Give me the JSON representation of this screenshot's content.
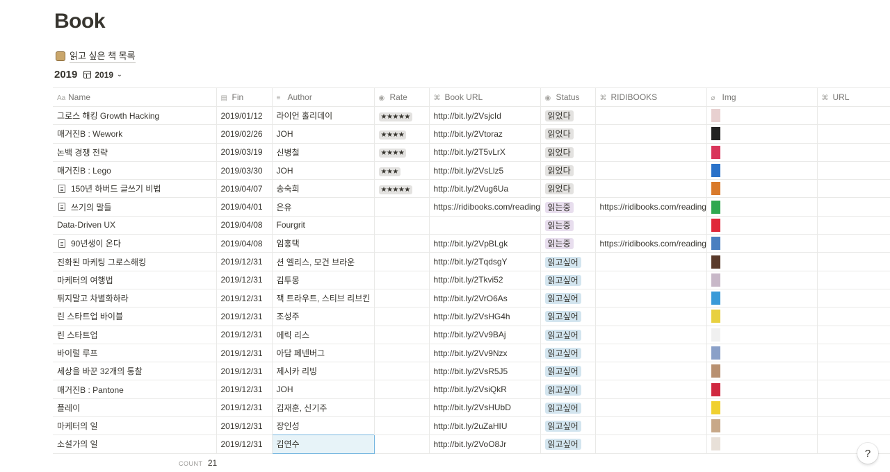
{
  "page": {
    "title": "Book"
  },
  "description": {
    "icon": "books-emoji-icon",
    "text": "읽고 싶은 책 목록"
  },
  "view": {
    "name": "2019",
    "switcher_label": "2019"
  },
  "columns": [
    {
      "label": "Name",
      "icon": "Aa"
    },
    {
      "label": "Fin",
      "icon": "▤"
    },
    {
      "label": "Author",
      "icon": "≡"
    },
    {
      "label": "Rate",
      "icon": "◉"
    },
    {
      "label": "Book URL",
      "icon": "⌘"
    },
    {
      "label": "Status",
      "icon": "◉"
    },
    {
      "label": "RIDIBOOKS",
      "icon": "⌘"
    },
    {
      "label": "Img",
      "icon": "⌀"
    },
    {
      "label": "URL",
      "icon": "⌘"
    }
  ],
  "rows": [
    {
      "name": "그로스 해킹 Growth Hacking",
      "doc": false,
      "fin": "2019/01/12",
      "author": "라이언 홀리데이",
      "rate": "★★★★★",
      "book_url": "http://bit.ly/2VsjcId",
      "status": "읽었다",
      "ridi": "",
      "img_color": "#e8d0d0"
    },
    {
      "name": "매거진B : Wework",
      "doc": false,
      "fin": "2019/02/26",
      "author": "JOH",
      "rate": "★★★★",
      "book_url": "http://bit.ly/2Vtoraz",
      "status": "읽었다",
      "ridi": "",
      "img_color": "#222222"
    },
    {
      "name": "논백 경쟁 전략",
      "doc": false,
      "fin": "2019/03/19",
      "author": "신병철",
      "rate": "★★★★",
      "book_url": "http://bit.ly/2T5vLrX",
      "status": "읽었다",
      "ridi": "",
      "img_color": "#d9355a"
    },
    {
      "name": "매거진B : Lego",
      "doc": false,
      "fin": "2019/03/30",
      "author": "JOH",
      "rate": "★★★",
      "book_url": "http://bit.ly/2VsLlz5",
      "status": "읽었다",
      "ridi": "",
      "img_color": "#2a72c9"
    },
    {
      "name": "150년 하버드 글쓰기 비법",
      "doc": true,
      "fin": "2019/04/07",
      "author": "송숙희",
      "rate": "★★★★★",
      "book_url": "http://bit.ly/2Vug6Ua",
      "status": "읽었다",
      "ridi": "",
      "img_color": "#d97a2b"
    },
    {
      "name": "쓰기의 말들",
      "doc": true,
      "fin": "2019/04/01",
      "author": "은유",
      "rate": "",
      "book_url": "https://ridibooks.com/reading",
      "status": "읽는중",
      "ridi": "https://ridibooks.com/reading",
      "img_color": "#2fa84f"
    },
    {
      "name": "Data-Driven UX",
      "doc": false,
      "fin": "2019/04/08",
      "author": "Fourgrit",
      "rate": "",
      "book_url": "",
      "status": "읽는중",
      "ridi": "",
      "img_color": "#e0283a"
    },
    {
      "name": "90년생이 온다",
      "doc": true,
      "fin": "2019/04/08",
      "author": "임홍택",
      "rate": "",
      "book_url": "http://bit.ly/2VpBLgk",
      "status": "읽는중",
      "ridi": "https://ridibooks.com/reading",
      "img_color": "#4a7fc0"
    },
    {
      "name": "진화된 마케팅 그로스해킹",
      "doc": false,
      "fin": "2019/12/31",
      "author": "션 엘리스, 모건 브라운",
      "rate": "",
      "book_url": "http://bit.ly/2TqdsgY",
      "status": "읽고싶어",
      "ridi": "",
      "img_color": "#5a3a2a"
    },
    {
      "name": "마케터의 여행법",
      "doc": false,
      "fin": "2019/12/31",
      "author": "김투몽",
      "rate": "",
      "book_url": "http://bit.ly/2Tkvi52",
      "status": "읽고싶어",
      "ridi": "",
      "img_color": "#c8b8c8"
    },
    {
      "name": "튀지말고 차별화하라",
      "doc": false,
      "fin": "2019/12/31",
      "author": "잭 트라우트, 스티브 리브킨",
      "rate": "",
      "book_url": "http://bit.ly/2VrO6As",
      "status": "읽고싶어",
      "ridi": "",
      "img_color": "#3a9ad8"
    },
    {
      "name": "린 스타트업 바이블",
      "doc": false,
      "fin": "2019/12/31",
      "author": "조성주",
      "rate": "",
      "book_url": "http://bit.ly/2VsHG4h",
      "status": "읽고싶어",
      "ridi": "",
      "img_color": "#e8d040"
    },
    {
      "name": "린 스타트업",
      "doc": false,
      "fin": "2019/12/31",
      "author": "에릭 리스",
      "rate": "",
      "book_url": "http://bit.ly/2Vv9BAj",
      "status": "읽고싶어",
      "ridi": "",
      "img_color": "#f0f0f0"
    },
    {
      "name": "바이럴 루프",
      "doc": false,
      "fin": "2019/12/31",
      "author": "아담 페넨버그",
      "rate": "",
      "book_url": "http://bit.ly/2Vv9Nzx",
      "status": "읽고싶어",
      "ridi": "",
      "img_color": "#8aa0c8"
    },
    {
      "name": "세상을 바꾼 32개의 통찰",
      "doc": false,
      "fin": "2019/12/31",
      "author": "제시카 리빙",
      "rate": "",
      "book_url": "http://bit.ly/2VsR5J5",
      "status": "읽고싶어",
      "ridi": "",
      "img_color": "#b89070"
    },
    {
      "name": "매거진B : Pantone",
      "doc": false,
      "fin": "2019/12/31",
      "author": "JOH",
      "rate": "",
      "book_url": "http://bit.ly/2VsiQkR",
      "status": "읽고싶어",
      "ridi": "",
      "img_color": "#d02840"
    },
    {
      "name": "플레이",
      "doc": false,
      "fin": "2019/12/31",
      "author": "김재훈, 신기주",
      "rate": "",
      "book_url": "http://bit.ly/2VsHUbD",
      "status": "읽고싶어",
      "ridi": "",
      "img_color": "#f0d030"
    },
    {
      "name": "마케터의 일",
      "doc": false,
      "fin": "2019/12/31",
      "author": "장인성",
      "rate": "",
      "book_url": "http://bit.ly/2uZaHIU",
      "status": "읽고싶어",
      "ridi": "",
      "img_color": "#c8a888"
    },
    {
      "name": "소설가의 일",
      "doc": false,
      "fin": "2019/12/31",
      "author": "김연수",
      "rate": "",
      "book_url": "http://bit.ly/2VoO8Jr",
      "status": "읽고싶어",
      "ridi": "",
      "img_color": "#e8e0d8"
    }
  ],
  "status_colors": {
    "읽었다": "#e3e2e0",
    "읽는중": "#e8deee",
    "읽고싶어": "#d3e5ef"
  },
  "footer": {
    "count_label": "COUNT",
    "count_value": "21"
  },
  "help": {
    "label": "?"
  }
}
